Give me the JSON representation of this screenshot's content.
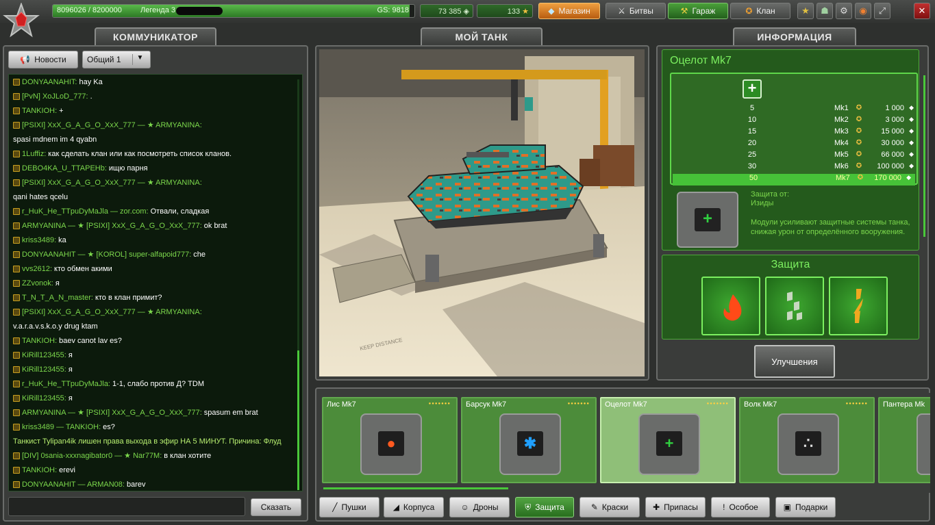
{
  "header": {
    "xp_text": "8096026 / 8200000",
    "xp_fraction": 0.987,
    "rank_name": "Легенда 3",
    "gs_text": "GS: 9818",
    "crystals": "73 385",
    "stars": "133",
    "shop_label": "Магазин",
    "battles_label": "Битвы",
    "garage_label": "Гараж",
    "clan_label": "Клан"
  },
  "tabs": {
    "communicator": "КОММУНИКАТОР",
    "my_tank": "МОЙ ТАНК",
    "info": "ИНФОРМАЦИЯ"
  },
  "chat": {
    "news_label": "Новости",
    "channel_label": "Общий 1",
    "send_label": "Сказать",
    "messages": [
      {
        "names": "DONYAANAHIT:",
        "text": "hay Ka"
      },
      {
        "names": "[PvN] XoJLoD_777:",
        "text": "."
      },
      {
        "names": "TANKIOH:",
        "text": "+"
      },
      {
        "names": "[PSIXI] XxX_G_A_G_O_XxX_777 — ★ ARMYANINA:",
        "text": ""
      },
      {
        "names": "",
        "text": "spasi mdnem im 4 qyabn"
      },
      {
        "names": "1Luffiz:",
        "text": "как сделать клан или как посмотреть список кланов."
      },
      {
        "names": "DEBO4KA_U_TTAPEHb:",
        "text": "ищю парня"
      },
      {
        "names": "[PSIXI] XxX_G_A_G_O_XxX_777 — ★ ARMYANINA:",
        "text": ""
      },
      {
        "names": "",
        "text": "qani hates qcelu"
      },
      {
        "names": "r_HuK_He_TTpuDyMaJla — zor.com:",
        "text": "Отвали, сладкая"
      },
      {
        "names": "ARMYANINA — ★ [PSIXI] XxX_G_A_G_O_XxX_777:",
        "text": "ok brat"
      },
      {
        "names": "kriss3489:",
        "text": "ka"
      },
      {
        "names": "DONYAANAHIT — ★ [KOROL] super-alfapoid777:",
        "text": "che"
      },
      {
        "names": "vvs2612:",
        "text": "кто обмен акими"
      },
      {
        "names": "ZZvonok:",
        "text": "я"
      },
      {
        "names": "T_N_T_A_N_master:",
        "text": "кто в клан примит?"
      },
      {
        "names": "[PSIXI] XxX_G_A_G_O_XxX_777 — ★ ARMYANINA:",
        "text": ""
      },
      {
        "names": "",
        "text": "v.a.r.a.v.s.k.o.y drug ktam"
      },
      {
        "names": "TANKIOH:",
        "text": "baev canot lav es?"
      },
      {
        "names": "KiRill123455:",
        "text": "я"
      },
      {
        "names": "KiRill123455:",
        "text": "я"
      },
      {
        "names": "r_HuK_He_TTpuDyMaJla:",
        "text": "1-1, слабо против Д? TDM"
      },
      {
        "names": "KiRill123455:",
        "text": "я"
      },
      {
        "names": "ARMYANINA — ★ [PSIXI] XxX_G_A_G_O_XxX_777:",
        "text": "spasum em brat"
      },
      {
        "names": "kriss3489 — TANKIOH:",
        "text": "es?"
      },
      {
        "names": "",
        "text": "",
        "sys": "Танкист Tylipan4ik лишен  права выхода в эфир НА 5 МИНУТ. Причина: Флуд"
      },
      {
        "names": "[DIV] 0sania-xxxnagibator0 — ★ Nar77M:",
        "text": "в клан хотите"
      },
      {
        "names": "TANKIOH:",
        "text": "erevi"
      },
      {
        "names": "DONYAANAHIT — ARMAN08:",
        "text": "barev"
      }
    ]
  },
  "info": {
    "title": "Оцелот Mk7",
    "protection_from": "Защита от:",
    "protection_type": "Изиды",
    "description": "Модули усиливают защитные системы танка, снижая урон от определённого вооружения.",
    "upgrades": [
      {
        "level": "5",
        "mk": "Mk1",
        "price": "1 000"
      },
      {
        "level": "10",
        "mk": "Mk2",
        "price": "3 000"
      },
      {
        "level": "15",
        "mk": "Mk3",
        "price": "15 000"
      },
      {
        "level": "20",
        "mk": "Mk4",
        "price": "30 000"
      },
      {
        "level": "25",
        "mk": "Mk5",
        "price": "66 000"
      },
      {
        "level": "30",
        "mk": "Mk6",
        "price": "100 000"
      },
      {
        "level": "50",
        "mk": "Mk7",
        "price": "170 000"
      }
    ],
    "protection_title": "Защита",
    "upgrades_button": "Улучшения"
  },
  "garage": {
    "items": [
      {
        "name": "Лис Mk7",
        "icon": "fire-icon",
        "color": "#ff5a20"
      },
      {
        "name": "Барсук Mk7",
        "icon": "snowflake-icon",
        "color": "#20a0ff"
      },
      {
        "name": "Оцелот Mk7",
        "icon": "plus-icon",
        "color": "#30d040"
      },
      {
        "name": "Волк Mk7",
        "icon": "dots-icon",
        "color": "#dddddd"
      },
      {
        "name": "Пантера Mk",
        "icon": "module-icon",
        "color": "#dddddd"
      }
    ],
    "categories": [
      "Пушки",
      "Корпуса",
      "Дроны",
      "Защита",
      "Краски",
      "Припасы",
      "Особое",
      "Подарки"
    ],
    "selected_category": "Защита"
  },
  "colors": {
    "accent_green": "#4ac83a",
    "panel": "#3a3c3a",
    "info_green": "#245a1c"
  }
}
